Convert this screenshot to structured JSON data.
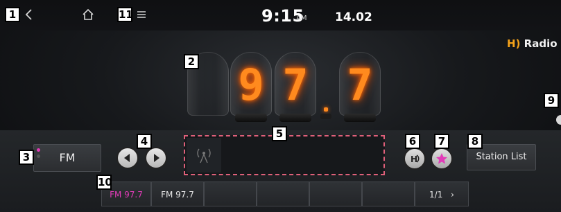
{
  "callouts": [
    "1",
    "2",
    "3",
    "4",
    "5",
    "6",
    "7",
    "8",
    "9",
    "10",
    "11"
  ],
  "status": {
    "time": "9:15",
    "ampm": "AM",
    "date": "14.02"
  },
  "brand": {
    "hd_prefix": "H",
    "hd_text": "Radio"
  },
  "frequency": {
    "digits": [
      "9",
      "7",
      "7"
    ],
    "display": "97.7",
    "glow_color": "#ff8a1e"
  },
  "band": {
    "label": "FM",
    "indicator_color": "#e23bb8"
  },
  "buttons": {
    "station_list": "Station List"
  },
  "presets": [
    {
      "label": "FM 97.7",
      "active": true
    },
    {
      "label": "FM 97.7",
      "hd": true
    },
    {
      "label": ""
    },
    {
      "label": ""
    },
    {
      "label": ""
    },
    {
      "label": ""
    },
    {
      "label": "1/1"
    }
  ],
  "colors": {
    "accent": "#e23bb8",
    "hd_orange": "#f5a31a",
    "panel_border": "#e0607a"
  }
}
